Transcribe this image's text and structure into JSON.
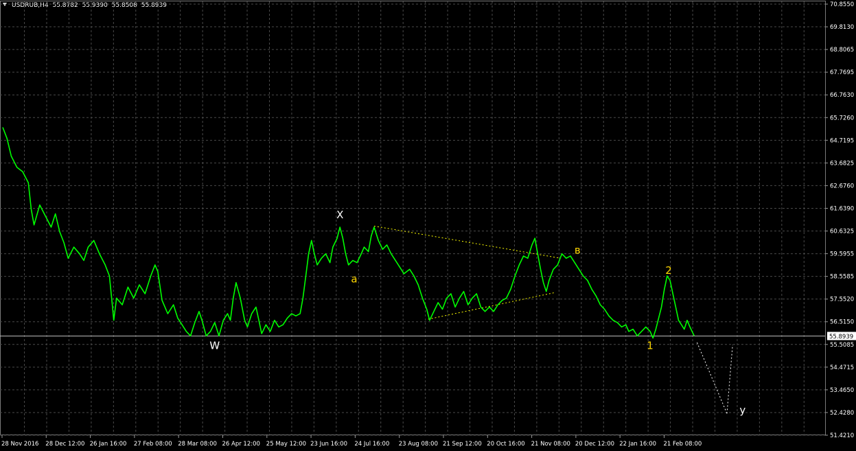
{
  "header": {
    "symbol": "USDRUB,H4",
    "open": "55.8782",
    "high": "55.9390",
    "low": "55.8508",
    "close": "55.8939"
  },
  "colors": {
    "background": "#000000",
    "grid": "#4a4a4a",
    "price_line": "#00ff00",
    "wave_label_white": "#ffffff",
    "wave_label_yellow": "#ffd700",
    "triangle_lines": "#ffff00",
    "projection": "#ffffff",
    "current_price_marker": "#ffffff"
  },
  "chart_data": {
    "type": "line",
    "ylim": [
      51.421,
      70.855
    ],
    "y_ticks": [
      "70.8550",
      "69.8130",
      "68.8065",
      "67.7695",
      "66.7630",
      "65.7260",
      "64.7195",
      "63.6825",
      "62.6760",
      "61.6390",
      "60.6325",
      "59.5955",
      "58.5585",
      "57.5520",
      "56.5150",
      "55.5085",
      "54.4715",
      "53.4650",
      "52.4280",
      "51.4210"
    ],
    "x_ticks": [
      "28 Nov 2016",
      "28 Dec 12:00",
      "26 Jan 16:00",
      "27 Feb 08:00",
      "28 Mar 08:00",
      "26 Apr 12:00",
      "25 May 12:00",
      "23 Jun 16:00",
      "24 Jul 16:00",
      "23 Aug 08:00",
      "21 Sep 12:00",
      "20 Oct 16:00",
      "21 Nov 08:00",
      "20 Dec 12:00",
      "22 Jan 16:00",
      "21 Feb 08:00"
    ],
    "current_price": "55.8939",
    "series": [
      {
        "points": [
          [
            0,
            65.3
          ],
          [
            0.15,
            64.8
          ],
          [
            0.3,
            64.0
          ],
          [
            0.5,
            63.5
          ],
          [
            0.7,
            63.3
          ],
          [
            0.9,
            62.8
          ],
          [
            1.0,
            61.6
          ],
          [
            1.1,
            60.9
          ],
          [
            1.3,
            61.8
          ],
          [
            1.5,
            61.3
          ],
          [
            1.7,
            60.8
          ],
          [
            1.85,
            61.4
          ],
          [
            2.0,
            60.6
          ],
          [
            2.15,
            60.1
          ],
          [
            2.3,
            59.4
          ],
          [
            2.5,
            59.9
          ],
          [
            2.7,
            59.6
          ],
          [
            2.85,
            59.3
          ],
          [
            3.0,
            59.9
          ],
          [
            3.2,
            60.2
          ],
          [
            3.4,
            59.6
          ],
          [
            3.6,
            59.1
          ],
          [
            3.75,
            58.6
          ],
          [
            3.85,
            57.3
          ],
          [
            3.9,
            56.6
          ],
          [
            4.0,
            57.6
          ],
          [
            4.2,
            57.3
          ],
          [
            4.4,
            58.1
          ],
          [
            4.6,
            57.6
          ],
          [
            4.8,
            58.2
          ],
          [
            5.0,
            57.8
          ],
          [
            5.2,
            58.6
          ],
          [
            5.35,
            59.1
          ],
          [
            5.45,
            58.8
          ],
          [
            5.6,
            57.5
          ],
          [
            5.8,
            56.9
          ],
          [
            6.0,
            57.3
          ],
          [
            6.15,
            56.7
          ],
          [
            6.3,
            56.4
          ],
          [
            6.45,
            56.1
          ],
          [
            6.6,
            55.9
          ],
          [
            6.75,
            56.5
          ],
          [
            6.9,
            57.0
          ],
          [
            7.0,
            56.6
          ],
          [
            7.15,
            55.9
          ],
          [
            7.3,
            56.1
          ],
          [
            7.45,
            56.5
          ],
          [
            7.6,
            55.9
          ],
          [
            7.75,
            56.6
          ],
          [
            7.9,
            56.9
          ],
          [
            8.0,
            56.6
          ],
          [
            8.1,
            57.6
          ],
          [
            8.2,
            58.3
          ],
          [
            8.35,
            57.6
          ],
          [
            8.5,
            56.6
          ],
          [
            8.6,
            56.3
          ],
          [
            8.75,
            56.9
          ],
          [
            8.9,
            57.2
          ],
          [
            9.0,
            56.6
          ],
          [
            9.1,
            56.0
          ],
          [
            9.25,
            56.4
          ],
          [
            9.4,
            56.1
          ],
          [
            9.55,
            56.6
          ],
          [
            9.7,
            56.3
          ],
          [
            9.85,
            56.4
          ],
          [
            10.0,
            56.7
          ],
          [
            10.15,
            56.9
          ],
          [
            10.3,
            56.8
          ],
          [
            10.45,
            56.9
          ],
          [
            10.55,
            57.6
          ],
          [
            10.65,
            58.6
          ],
          [
            10.75,
            59.6
          ],
          [
            10.85,
            60.2
          ],
          [
            10.95,
            59.6
          ],
          [
            11.05,
            59.1
          ],
          [
            11.2,
            59.4
          ],
          [
            11.35,
            59.6
          ],
          [
            11.5,
            59.2
          ],
          [
            11.6,
            59.9
          ],
          [
            11.75,
            60.3
          ],
          [
            11.85,
            60.8
          ],
          [
            11.95,
            60.3
          ],
          [
            12.05,
            59.6
          ],
          [
            12.15,
            59.1
          ],
          [
            12.3,
            59.3
          ],
          [
            12.45,
            59.2
          ],
          [
            12.6,
            59.6
          ],
          [
            12.7,
            59.9
          ],
          [
            12.85,
            59.7
          ],
          [
            12.95,
            60.4
          ],
          [
            13.05,
            60.8
          ],
          [
            13.2,
            60.2
          ],
          [
            13.35,
            59.8
          ],
          [
            13.5,
            60.0
          ],
          [
            13.65,
            59.6
          ],
          [
            13.8,
            59.3
          ],
          [
            13.95,
            59.0
          ],
          [
            14.1,
            58.7
          ],
          [
            14.3,
            58.9
          ],
          [
            14.45,
            58.6
          ],
          [
            14.6,
            58.2
          ],
          [
            14.75,
            57.6
          ],
          [
            14.9,
            57.1
          ],
          [
            15.0,
            56.6
          ],
          [
            15.15,
            57.0
          ],
          [
            15.3,
            57.4
          ],
          [
            15.45,
            57.1
          ],
          [
            15.6,
            57.6
          ],
          [
            15.75,
            57.8
          ],
          [
            15.9,
            57.2
          ],
          [
            16.05,
            57.6
          ],
          [
            16.2,
            57.9
          ],
          [
            16.35,
            57.3
          ],
          [
            16.5,
            57.6
          ],
          [
            16.65,
            57.8
          ],
          [
            16.8,
            57.2
          ],
          [
            16.95,
            57.0
          ],
          [
            17.1,
            57.2
          ],
          [
            17.25,
            57.0
          ],
          [
            17.4,
            57.3
          ],
          [
            17.55,
            57.5
          ],
          [
            17.7,
            57.6
          ],
          [
            17.85,
            58.0
          ],
          [
            18.0,
            58.6
          ],
          [
            18.15,
            59.1
          ],
          [
            18.3,
            59.5
          ],
          [
            18.45,
            59.4
          ],
          [
            18.6,
            60.0
          ],
          [
            18.7,
            60.3
          ],
          [
            18.8,
            59.6
          ],
          [
            18.9,
            58.9
          ],
          [
            19.0,
            58.3
          ],
          [
            19.1,
            57.9
          ],
          [
            19.2,
            58.4
          ],
          [
            19.35,
            58.9
          ],
          [
            19.5,
            59.1
          ],
          [
            19.65,
            59.6
          ],
          [
            19.8,
            59.4
          ],
          [
            19.95,
            59.5
          ],
          [
            20.1,
            59.2
          ],
          [
            20.25,
            58.9
          ],
          [
            20.4,
            58.6
          ],
          [
            20.55,
            58.4
          ],
          [
            20.7,
            58.0
          ],
          [
            20.85,
            57.7
          ],
          [
            21.0,
            57.3
          ],
          [
            21.15,
            57.1
          ],
          [
            21.3,
            56.8
          ],
          [
            21.45,
            56.6
          ],
          [
            21.6,
            56.5
          ],
          [
            21.75,
            56.3
          ],
          [
            21.9,
            56.4
          ],
          [
            22.0,
            56.1
          ],
          [
            22.15,
            56.2
          ],
          [
            22.3,
            55.9
          ],
          [
            22.45,
            56.1
          ],
          [
            22.6,
            56.3
          ],
          [
            22.75,
            56.1
          ],
          [
            22.85,
            55.8
          ],
          [
            22.95,
            56.2
          ],
          [
            23.05,
            56.7
          ],
          [
            23.15,
            57.2
          ],
          [
            23.25,
            58.0
          ],
          [
            23.35,
            58.6
          ],
          [
            23.45,
            58.4
          ],
          [
            23.55,
            57.8
          ],
          [
            23.65,
            57.2
          ],
          [
            23.75,
            56.6
          ],
          [
            23.85,
            56.4
          ],
          [
            23.95,
            56.2
          ],
          [
            24.05,
            56.6
          ],
          [
            24.15,
            56.3
          ],
          [
            24.3,
            55.9
          ]
        ]
      }
    ],
    "annotations": [
      {
        "text": "W",
        "at": [
          7.45,
          55.3
        ],
        "color": "white"
      },
      {
        "text": "X",
        "at": [
          11.85,
          61.2
        ],
        "color": "white"
      },
      {
        "text": "a",
        "at": [
          12.35,
          58.3
        ],
        "color": "yellow"
      },
      {
        "text": "в",
        "at": [
          20.2,
          59.6
        ],
        "color": "yellow"
      },
      {
        "text": "2",
        "at": [
          23.4,
          58.7
        ],
        "color": "yellow"
      },
      {
        "text": "1",
        "at": [
          22.75,
          55.3
        ],
        "color": "yellow"
      },
      {
        "text": "y",
        "at": [
          26.0,
          52.4
        ],
        "color": "white"
      }
    ],
    "triangle": [
      {
        "from": [
          13.05,
          60.85
        ],
        "to": [
          19.6,
          59.4
        ]
      },
      {
        "from": [
          14.95,
          56.65
        ],
        "to": [
          19.4,
          57.85
        ]
      }
    ],
    "projection": {
      "from": [
        24.4,
        55.6
      ],
      "to": [
        25.45,
        52.4
      ],
      "to2": [
        25.65,
        55.5
      ]
    }
  }
}
